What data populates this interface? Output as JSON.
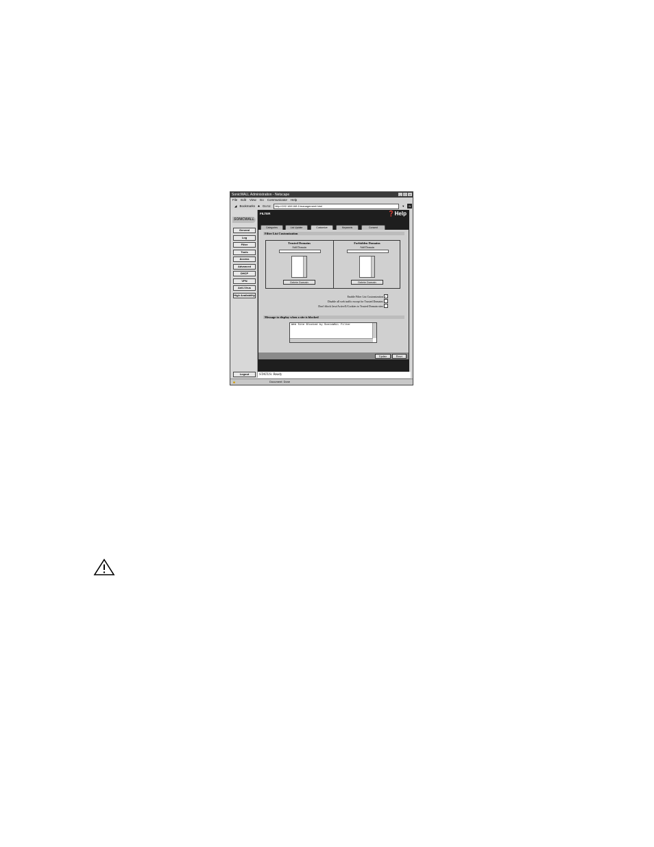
{
  "window": {
    "title": "SonicWALL Administration - Netscape",
    "menu": [
      "File",
      "Edit",
      "View",
      "Go",
      "Communicator",
      "Help"
    ],
    "toolbar": {
      "bookmarks_label": "Bookmarks",
      "location_label": "Go to:",
      "url": "http://192.168.168.1/management.html"
    },
    "status_bar": "Document: Done"
  },
  "sidebar": {
    "logo": "SONICWALL",
    "items": [
      "General",
      "Log",
      "Filter",
      "Tools",
      "Access",
      "Advanced",
      "DHCP",
      "VPN",
      "Anti-Virus",
      "High Availability"
    ],
    "logout": "Logout"
  },
  "header": {
    "section": "FILTER",
    "help": "Help"
  },
  "tabs": [
    "Categories",
    "List Update",
    "Customize",
    "Keywords",
    "Consent"
  ],
  "customize": {
    "section_title": "Filter List Customization",
    "trusted": {
      "title": "Trusted Domains",
      "sub": "Add Domain",
      "button": "Delete Domain"
    },
    "forbidden": {
      "title": "Forbidden Domains",
      "sub": "Add Domain",
      "button": "Delete Domain"
    },
    "options": [
      {
        "label": "Enable Filter List Customization",
        "checked": true
      },
      {
        "label": "Disable all web traffic except for Trusted Domains",
        "checked": false
      },
      {
        "label": "Don't block Java/ActiveX/Cookies to Trusted Domain sites",
        "checked": false
      }
    ],
    "message_title": "Message to display when a site is blocked",
    "message_value": "Web Site Blocked by SonicWALL Filter"
  },
  "actions": {
    "update": "Update",
    "reset": "Reset"
  },
  "status": "STATUS: Ready"
}
